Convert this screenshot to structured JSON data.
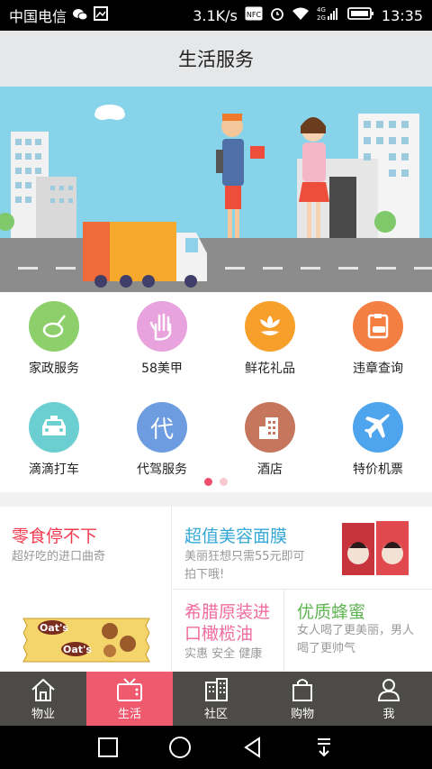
{
  "status_bar": {
    "carrier": "中国电信",
    "speed": "3.1K/s",
    "nfc": "NFC",
    "network_4g": "4G",
    "network_2g": "2G",
    "time": "13:35"
  },
  "title_bar": {
    "title": "生活服务"
  },
  "services": [
    {
      "label": "家政服务",
      "icon": "housekeeping-icon",
      "color": "#8dcf6a"
    },
    {
      "label": "58美甲",
      "icon": "manicure-hand-icon",
      "color": "#e8a2dd"
    },
    {
      "label": "鲜花礼品",
      "icon": "flower-icon",
      "color": "#f6a02b"
    },
    {
      "label": "违章查询",
      "icon": "traffic-violation-icon",
      "color": "#f37f42"
    },
    {
      "label": "滴滴打车",
      "icon": "taxi-icon",
      "color": "#6bcfd1"
    },
    {
      "label": "代驾服务",
      "icon": "designated-driver-icon",
      "color": "#6d9de0",
      "glyph": "代"
    },
    {
      "label": "酒店",
      "icon": "hotel-building-icon",
      "color": "#c7765e"
    },
    {
      "label": "特价机票",
      "icon": "airplane-icon",
      "color": "#4ea4ed"
    }
  ],
  "carousel": {
    "total": 2,
    "active": 0
  },
  "promos": {
    "snacks": {
      "title": "零食停不下",
      "subtitle": "超好吃的进口曲奇",
      "title_color": "#f23b4f",
      "product_text": "Oat's"
    },
    "mask": {
      "title": "超值美容面膜",
      "subtitle_line1": "美丽狂想只需55元即可",
      "subtitle_line2": "拍下哦!",
      "title_color": "#35a8d6"
    },
    "olive": {
      "title_line1": "希腊原装进",
      "title_line2": "口橄榄油",
      "subtitle": "实惠 安全 健康",
      "title_color": "#f06c9d"
    },
    "honey": {
      "title": "优质蜂蜜",
      "subtitle_line1": "女人喝了更美丽，男人",
      "subtitle_line2": "喝了更帅气",
      "title_color": "#5fb452"
    }
  },
  "tabs": [
    {
      "label": "物业",
      "icon": "home-icon",
      "active": false
    },
    {
      "label": "生活",
      "icon": "tv-icon",
      "active": true
    },
    {
      "label": "社区",
      "icon": "buildings-icon",
      "active": false
    },
    {
      "label": "购物",
      "icon": "shopping-bag-icon",
      "active": false
    },
    {
      "label": "我",
      "icon": "person-icon",
      "active": false
    }
  ]
}
